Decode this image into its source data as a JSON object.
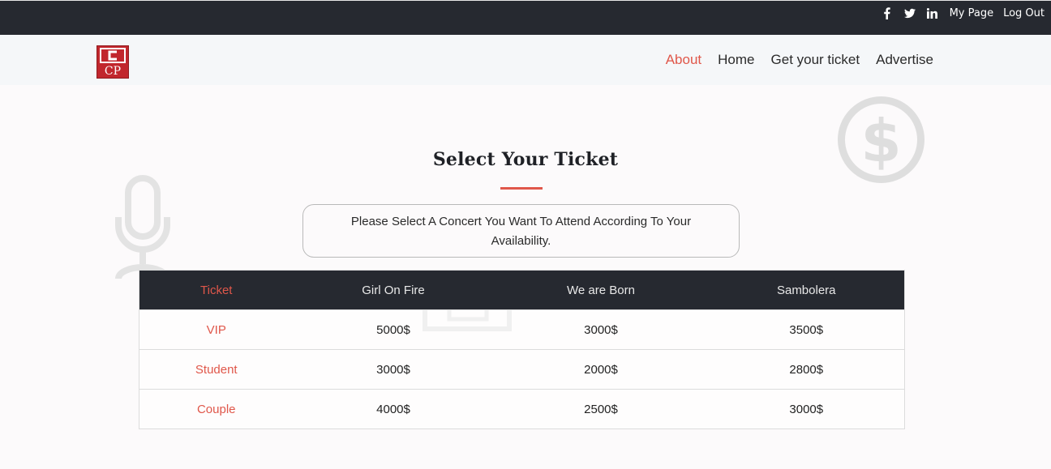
{
  "topbar": {
    "social_icons": [
      "facebook-icon",
      "twitter-icon",
      "linkedin-icon"
    ],
    "links": [
      "My Page",
      "Log Out"
    ]
  },
  "navbar": {
    "logo_text": "CP",
    "items": [
      {
        "label": "About",
        "active": true
      },
      {
        "label": "Home",
        "active": false
      },
      {
        "label": "Get your ticket",
        "active": false
      },
      {
        "label": "Advertise",
        "active": false
      }
    ]
  },
  "main": {
    "title": "Select Your Ticket",
    "notice": "Please Select A Concert You Want To Attend According To Your Availability."
  },
  "table": {
    "headers": [
      "Ticket",
      "Girl On Fire",
      "We are Born",
      "Sambolera"
    ],
    "rows": [
      [
        "VIP",
        "5000$",
        "3000$",
        "3500$"
      ],
      [
        "Student",
        "3000$",
        "2000$",
        "2800$"
      ],
      [
        "Couple",
        "4000$",
        "2500$",
        "3000$"
      ]
    ]
  },
  "colors": {
    "accent": "#e0574a",
    "dark": "#262930",
    "nav_bg": "#f5f7f9"
  }
}
